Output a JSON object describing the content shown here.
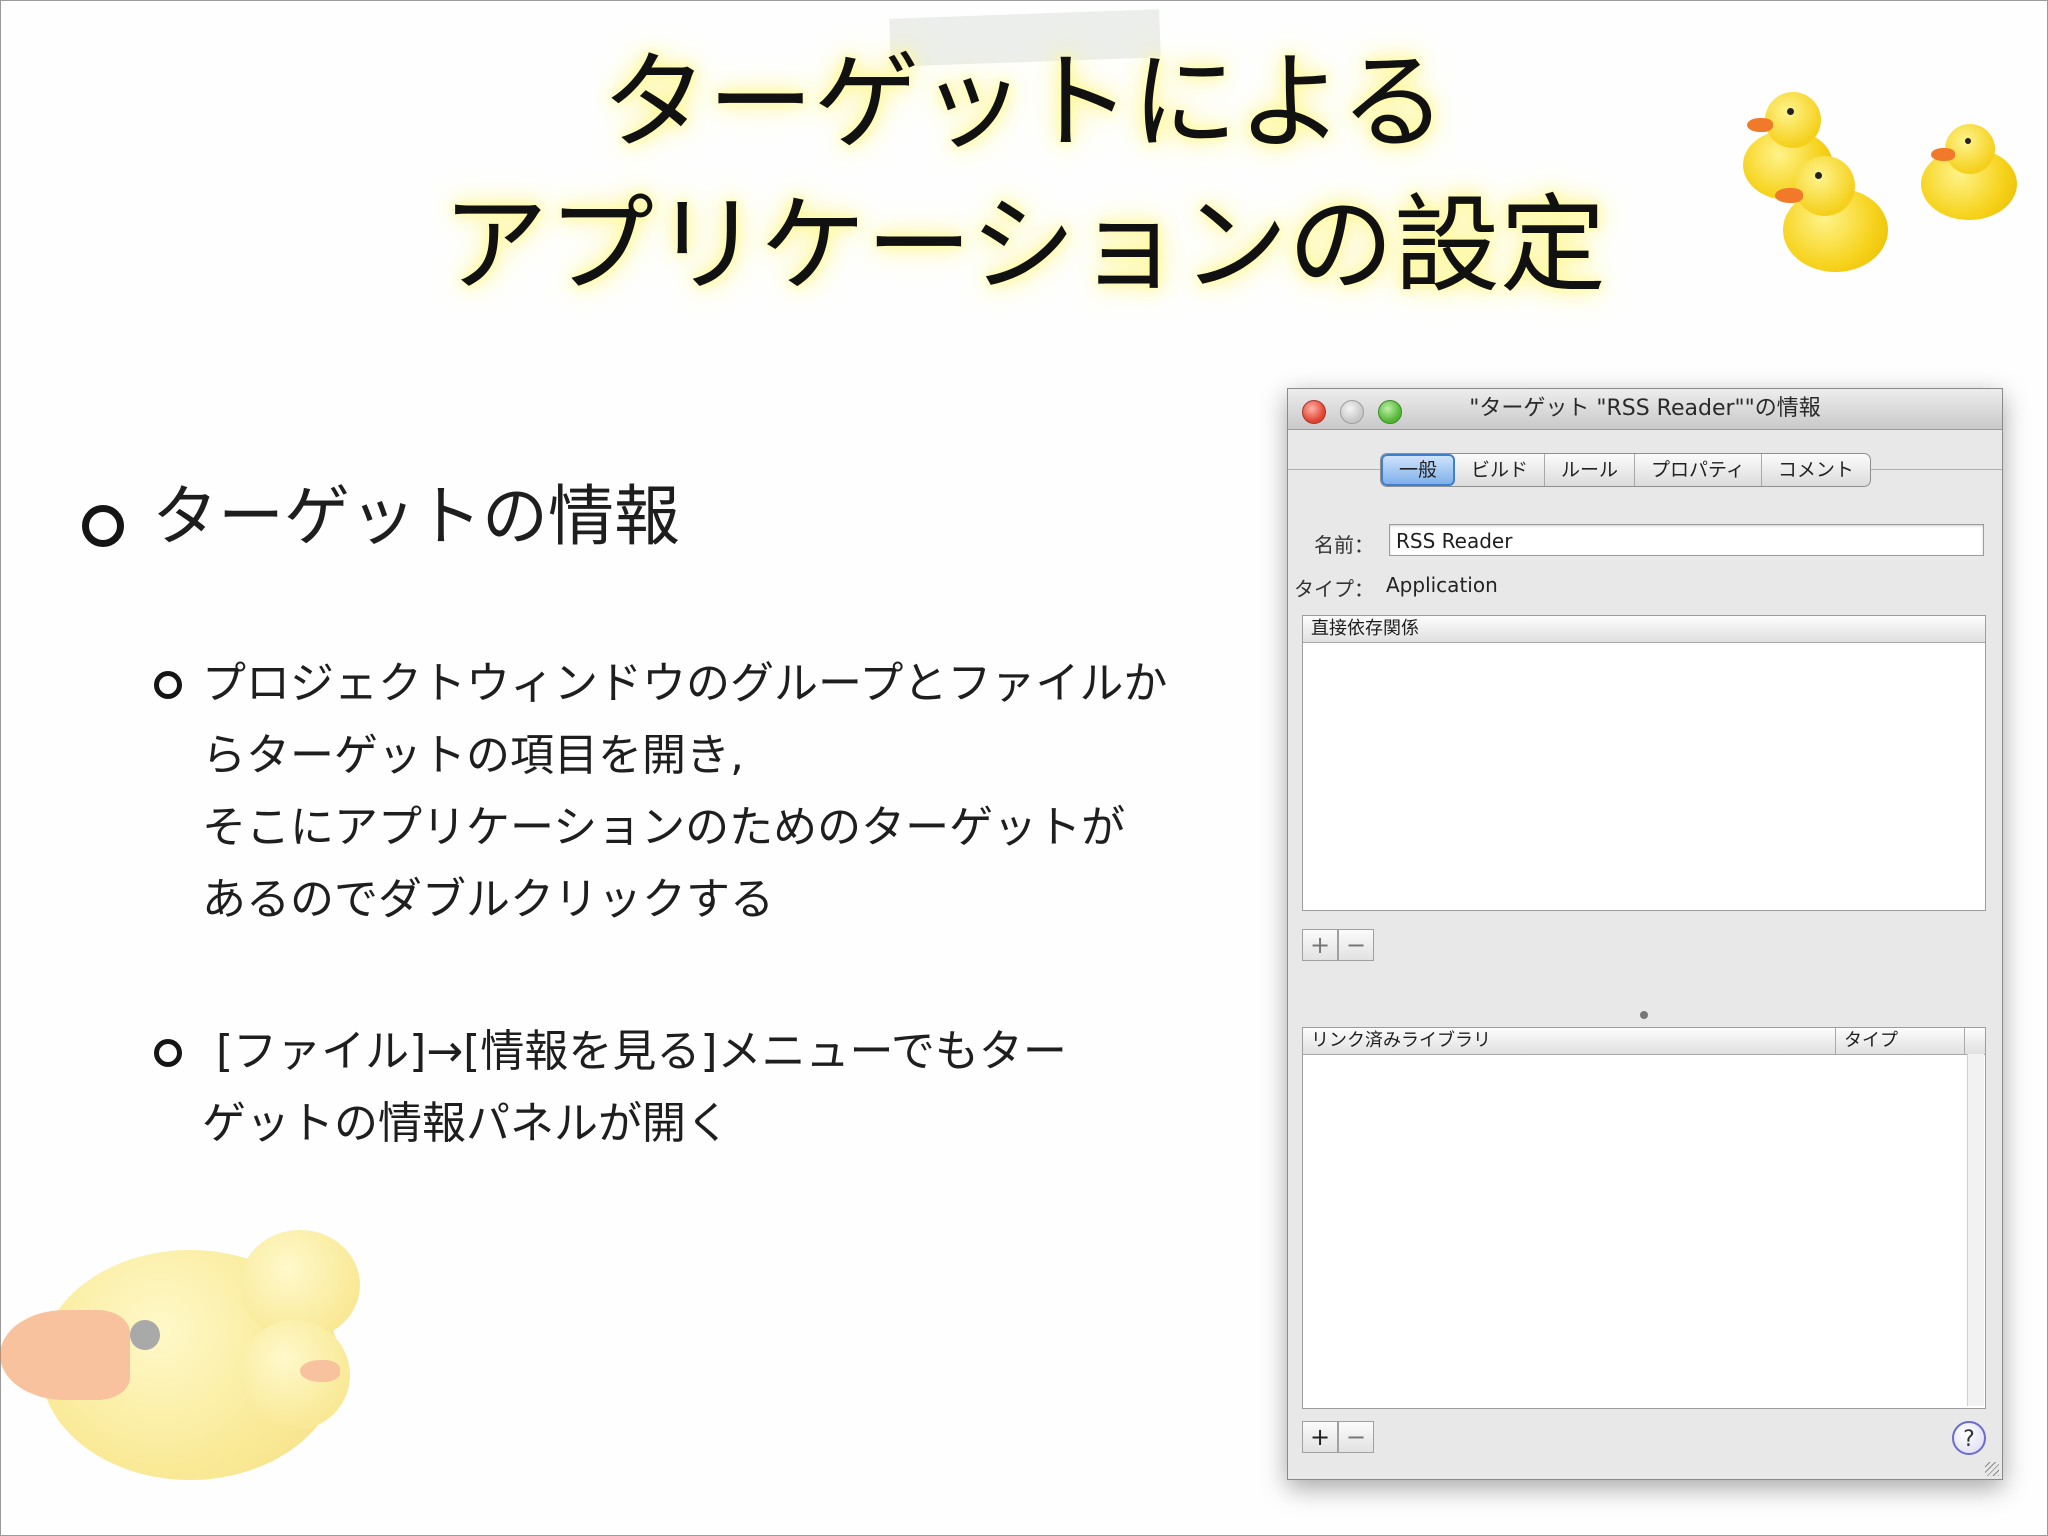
{
  "slide": {
    "title_line1": "ターゲットによる",
    "title_line2": "アプリケーションの設定",
    "main_bullet": "ターゲットの情報",
    "sub_bullet1_lines": [
      "プロジェクトウィンドウのグループとファイルか",
      "らターゲットの項目を開き,",
      "そこにアプリケーションのためのターゲットが",
      "あるのでダブルクリックする"
    ],
    "sub_bullet2_lines": [
      " [ファイル]→[情報を見る]メニューでもター",
      "ゲットの情報パネルが開く"
    ]
  },
  "window": {
    "title": "\"ターゲット \"RSS Reader\"\"の情報",
    "tabs": [
      {
        "label": "一般",
        "active": true
      },
      {
        "label": "ビルド",
        "active": false
      },
      {
        "label": "ルール",
        "active": false
      },
      {
        "label": "プロパティ",
        "active": false
      },
      {
        "label": "コメント",
        "active": false
      }
    ],
    "name_label": "名前：",
    "name_value": "RSS Reader",
    "type_label": "タイプ：",
    "type_value": "Application",
    "deps_header": "直接依存関係",
    "libs_header": "リンク済みライブラリ",
    "libs_type_header": "タイプ",
    "add_label": "+",
    "remove_label": "−",
    "help_label": "?"
  },
  "colors": {
    "title_glow": "#fff68a",
    "duck_yellow": "#f6d21a",
    "duck_beak": "#f07a2a",
    "active_tab": "#7eb0ea",
    "close_button": "#e14332",
    "zoom_button": "#52b534"
  }
}
